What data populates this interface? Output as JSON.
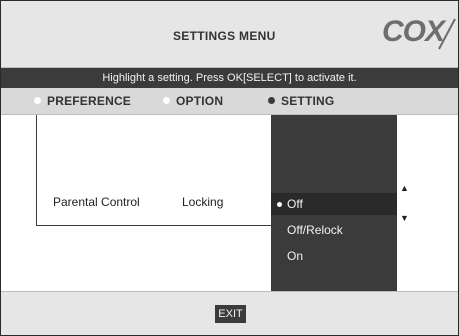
{
  "header": {
    "title": "SETTINGS MENU",
    "logo": "COX"
  },
  "banner": {
    "text": "Highlight a setting. Press OK[SELECT] to activate it."
  },
  "tabs": [
    {
      "label": "PREFERENCE",
      "active": false
    },
    {
      "label": "OPTION",
      "active": false
    },
    {
      "label": "SETTING",
      "active": true
    }
  ],
  "row": {
    "preference": "Parental Control",
    "option": "Locking"
  },
  "settings": {
    "options": [
      "Off",
      "Off/Relock",
      "On"
    ],
    "selected": "Off"
  },
  "footer": {
    "exit_label": "EXIT"
  }
}
